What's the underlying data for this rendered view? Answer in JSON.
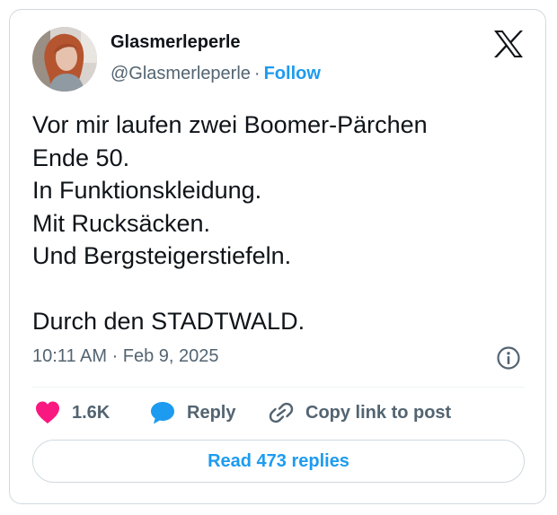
{
  "author": {
    "display_name": "Glasmerleperle",
    "handle": "@Glasmerleperle",
    "separator": "·",
    "follow_label": "Follow"
  },
  "tweet": {
    "lines": [
      "Vor mir laufen zwei Boomer-Pärchen",
      "Ende 50.",
      "In Funktionskleidung.",
      "Mit Rucksäcken.",
      "Und Bergsteigerstiefeln.",
      "",
      "Durch den STADTWALD."
    ],
    "timestamp": "10:11 AM · Feb 9, 2025"
  },
  "actions": {
    "like_count": "1.6K",
    "reply_label": "Reply",
    "copy_link_label": "Copy link to post",
    "read_replies_label": "Read 473 replies"
  },
  "icons": {
    "brand": "x-logo-icon",
    "info": "info-icon",
    "like": "heart-icon",
    "reply": "speech-bubble-icon",
    "copy": "link-icon"
  },
  "colors": {
    "accent": "#1d9bf0",
    "like": "#f91880",
    "text": "#0f1419",
    "muted": "#536471",
    "border": "#cfd9de"
  }
}
